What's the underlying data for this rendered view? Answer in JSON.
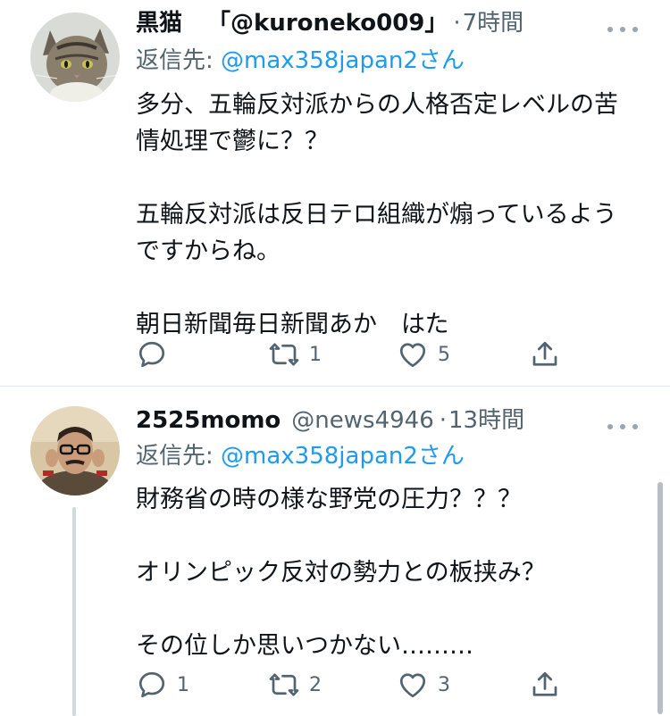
{
  "tweets": [
    {
      "display_name": "黒猫",
      "handle": "「@kuroneko009」",
      "dot": "·",
      "time": "7時間",
      "reply_prefix": "返信先:",
      "reply_handle": "@max358japan2さん",
      "body_lines": [
        "多分、五輪反対派からの人格否定レベルの苦",
        "情処理で鬱に？？",
        "",
        "五輪反対派は反日テロ組織が煽っているよう",
        "ですからね。",
        "",
        "朝日新聞毎日新聞あか　はた"
      ],
      "reply_count": "",
      "retweet_count": "1",
      "like_count": "5",
      "avatar_icon": "cat-avatar"
    },
    {
      "display_name": "2525momo",
      "handle": "@news4946",
      "dot": "·",
      "time": "13時間",
      "reply_prefix": "返信先:",
      "reply_handle": "@max358japan2さん",
      "body_lines": [
        "財務省の時の様な野党の圧力？？？",
        "",
        "オリンピック反対の勢力との板挟み？",
        "",
        "その位しか思いつかない………"
      ],
      "reply_count": "1",
      "retweet_count": "2",
      "like_count": "3",
      "avatar_icon": "person-avatar"
    }
  ],
  "icons": {
    "reply": "reply-icon",
    "retweet": "retweet-icon",
    "like": "heart-icon",
    "share": "share-icon",
    "more": "more-icon"
  },
  "colors": {
    "text": "#0f1419",
    "secondary": "#536471",
    "link": "#1d9bf0",
    "divider": "#e1e6ea"
  }
}
